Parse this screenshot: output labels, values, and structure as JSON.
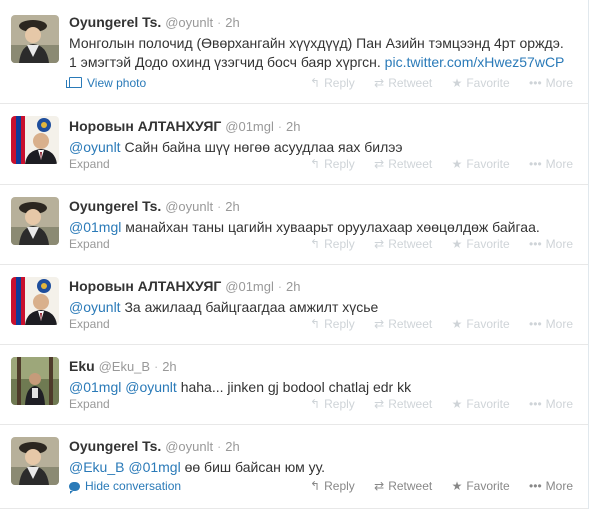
{
  "actions": {
    "reply": "Reply",
    "retweet": "Retweet",
    "favorite": "Favorite",
    "more": "More",
    "reply_icon": "reply-arrow-icon",
    "retweet_icon": "retweet-icon",
    "favorite_icon": "star-icon"
  },
  "tweets": [
    {
      "fullname": "Oyungerel Ts.",
      "username": "@oyunlt",
      "dot": "·",
      "time": "2h",
      "line1": "Монголын полочид (Өвөрхангайн хүүхдүүд) Пан Азийн тэмцээнд 4рт орждэ.",
      "line2_text": "1 эмэгтэй Додо охинд үзэгчид босч баяр хүргсн. ",
      "line2_link": "pic.twitter.com/xHwez57wCP",
      "footer": "View photo"
    },
    {
      "fullname": "Норовын АЛТАНХУЯГ",
      "username": "@01mgl",
      "dot": "·",
      "time": "2h",
      "mention": "@oyunlt",
      "text": " Сайн байна шүү нөгөө асуудлаа яах билээ",
      "footer": "Expand"
    },
    {
      "fullname": "Oyungerel Ts.",
      "username": "@oyunlt",
      "dot": "·",
      "time": "2h",
      "mention": "@01mgl",
      "text": " манайхан таны цагийн хуваарьт оруулахаар хөөцөлдөж байгаа.",
      "footer": "Expand"
    },
    {
      "fullname": "Норовын АЛТАНХУЯГ",
      "username": "@01mgl",
      "dot": "·",
      "time": "2h",
      "mention": "@oyunlt",
      "text": " За ажилаад байцгаагдаа амжилт хүсье",
      "footer": "Expand"
    },
    {
      "fullname": "Eku",
      "username": "@Eku_B",
      "dot": "·",
      "time": "2h",
      "mention": "@01mgl",
      "mention2": "@oyunlt",
      "text": " haha... jinken gj bodool chatlaj edr kk",
      "footer": "Expand"
    },
    {
      "fullname": "Oyungerel Ts.",
      "username": "@oyunlt",
      "dot": "·",
      "time": "2h",
      "mention": "@Eku_B",
      "mention2": "@01mgl",
      "text": " өө биш байсан юм уу.",
      "footer": "Hide conversation"
    }
  ]
}
